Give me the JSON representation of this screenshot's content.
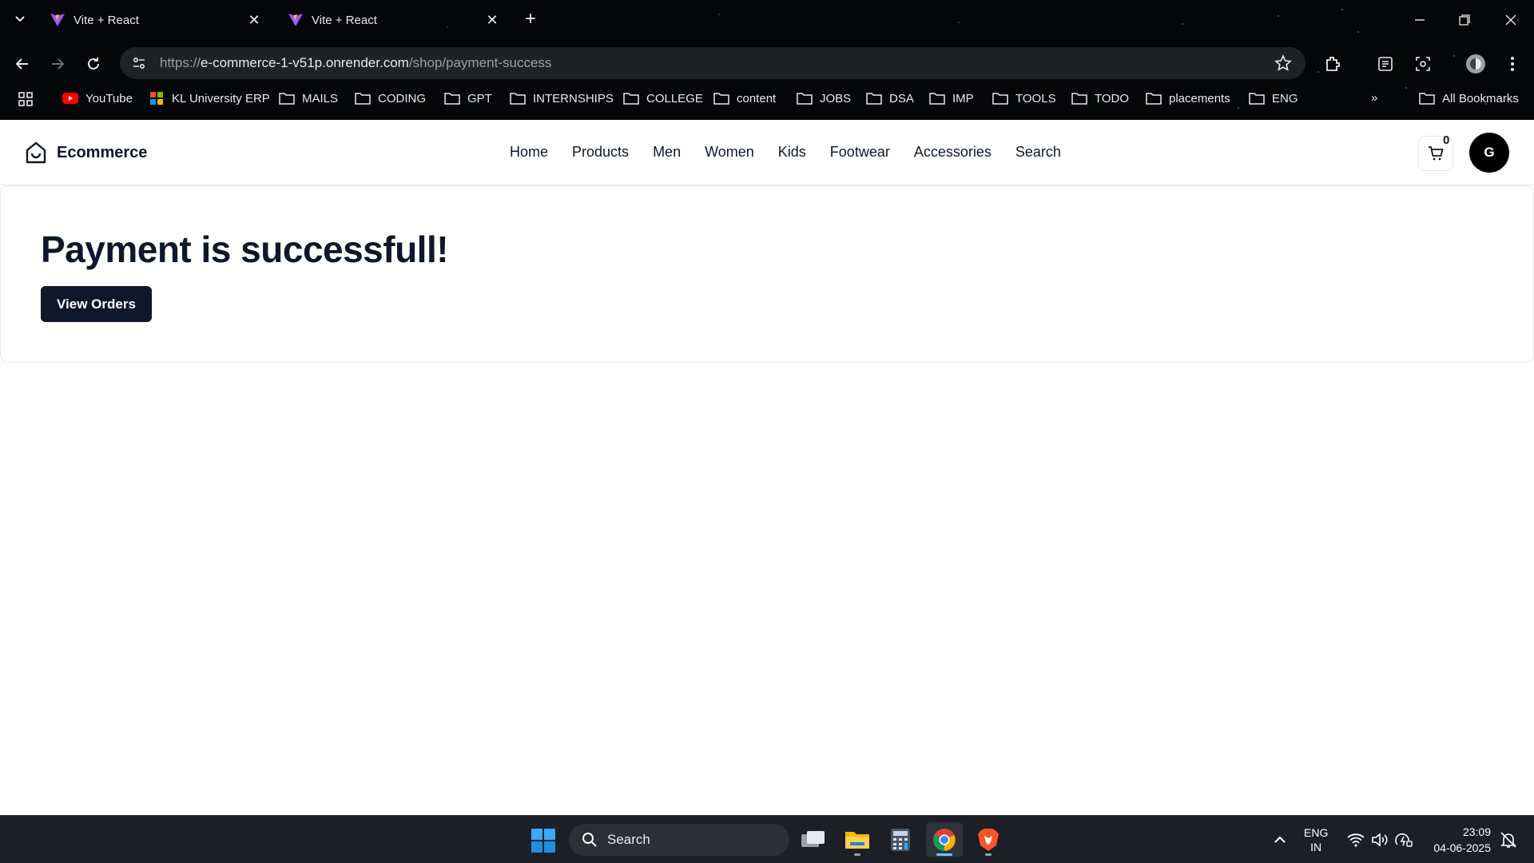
{
  "browser": {
    "tabs": [
      {
        "title": "Vite + React",
        "close": "✕"
      },
      {
        "title": "Vite + React",
        "close": "✕"
      }
    ],
    "new_tab": "+",
    "url": {
      "scheme": "https://",
      "host": "e-commerce-1-v51p.onrender.com",
      "path": "/shop/payment-success"
    },
    "bookmarks": [
      {
        "label": "YouTube",
        "icon": "youtube-icon"
      },
      {
        "label": "KL University ERP",
        "icon": "erp-icon"
      },
      {
        "label": "MAILS",
        "icon": "folder-icon"
      },
      {
        "label": "CODING",
        "icon": "folder-icon"
      },
      {
        "label": "GPT",
        "icon": "folder-icon"
      },
      {
        "label": "INTERNSHIPS",
        "icon": "folder-icon"
      },
      {
        "label": "COLLEGE",
        "icon": "folder-icon"
      },
      {
        "label": "content",
        "icon": "folder-icon"
      },
      {
        "label": "JOBS",
        "icon": "folder-icon"
      },
      {
        "label": "DSA",
        "icon": "folder-icon"
      },
      {
        "label": "IMP",
        "icon": "folder-icon"
      },
      {
        "label": "TOOLS",
        "icon": "folder-icon"
      },
      {
        "label": "TODO",
        "icon": "folder-icon"
      },
      {
        "label": "placements",
        "icon": "folder-icon"
      },
      {
        "label": "ENG",
        "icon": "folder-icon"
      }
    ],
    "more_bookmarks": "»",
    "all_bookmarks": "All Bookmarks"
  },
  "site": {
    "brand": "Ecommerce",
    "nav": [
      "Home",
      "Products",
      "Men",
      "Women",
      "Kids",
      "Footwear",
      "Accessories",
      "Search"
    ],
    "cart_count": "0",
    "avatar_initial": "G"
  },
  "content": {
    "heading": "Payment is successfull!",
    "button": "View Orders"
  },
  "taskbar": {
    "search_label": "Search",
    "lang_line1": "ENG",
    "lang_line2": "IN",
    "time": "23:09",
    "date": "04-06-2025"
  },
  "colors": {
    "primary": "#0f172a",
    "chrome_bg": "#050608",
    "taskbar_bg": "#1c1f26",
    "border": "#e5e7eb"
  }
}
